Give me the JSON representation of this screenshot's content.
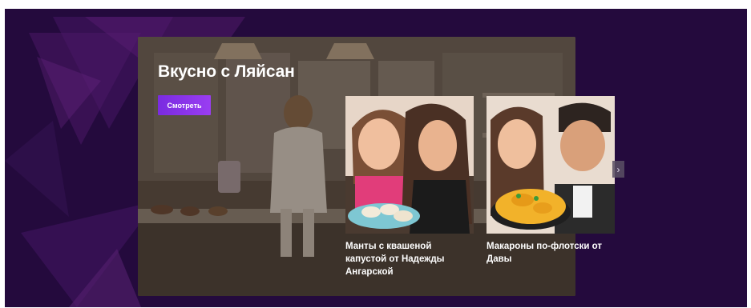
{
  "hero": {
    "title": "Вкусно с Ляйсан",
    "watch_label": "Смотреть"
  },
  "cards": [
    {
      "caption": "Манты с квашеной капустой от Надежды Ангарской"
    },
    {
      "caption": "Макароны по-флотски от Давы"
    }
  ],
  "carousel": {
    "next_icon": "chevron-right-icon",
    "next_glyph": "›"
  },
  "colors": {
    "background": "#240a3d",
    "accent": "#8b35ea"
  }
}
